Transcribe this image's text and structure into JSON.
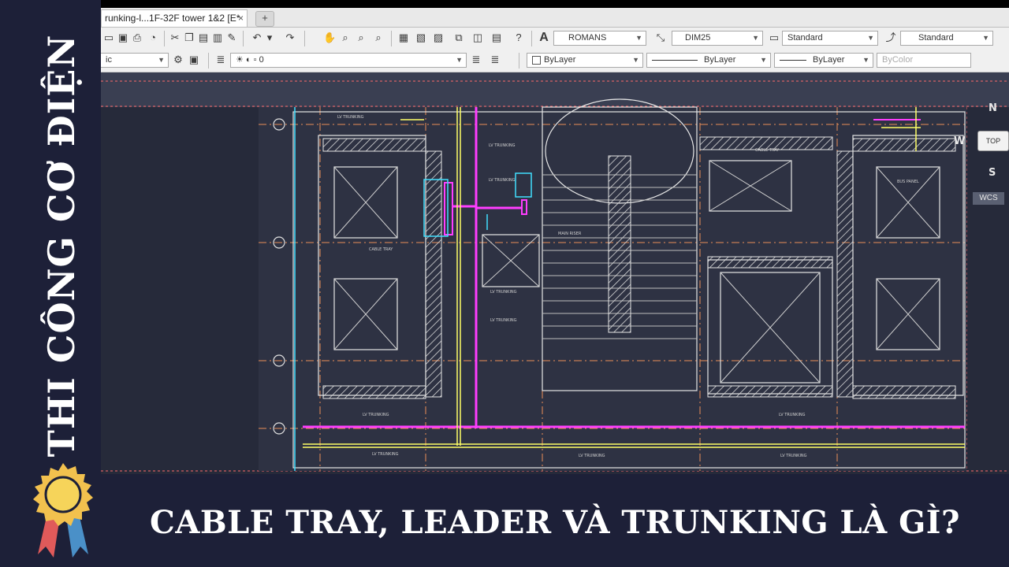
{
  "sidebar": {
    "title": "THI CÔNG CƠ ĐIỆN",
    "badge_icon": "award-ribbon-icon"
  },
  "caption": {
    "text": "CABLE TRAY, LEADER VÀ TRUNKING LÀ GÌ?"
  },
  "app": {
    "tab_title": "runking-l...1F-32F tower 1&2 [E*",
    "new_tab": "+",
    "toolbar1": {
      "text_style": "ROMANS",
      "dim_style": "DIM25",
      "table_style": "Standard",
      "multileader_style": "Standard"
    },
    "toolbar2": {
      "workspace": "ic",
      "layer": "0",
      "color": "ByLayer",
      "linetype": "ByLayer",
      "lineweight": "ByLayer",
      "plot_style": "ByColor"
    },
    "viewcube": {
      "north": "N",
      "west": "W",
      "south": "S",
      "top": "TOP",
      "ucs": "WCS"
    }
  },
  "colors": {
    "background": "#1d2038",
    "canvas": "#262a3a",
    "cable_tray": "#ff3dff",
    "trunking": "#ffff66",
    "leader": "#40e0ff",
    "grid": "#ff9a5a"
  }
}
